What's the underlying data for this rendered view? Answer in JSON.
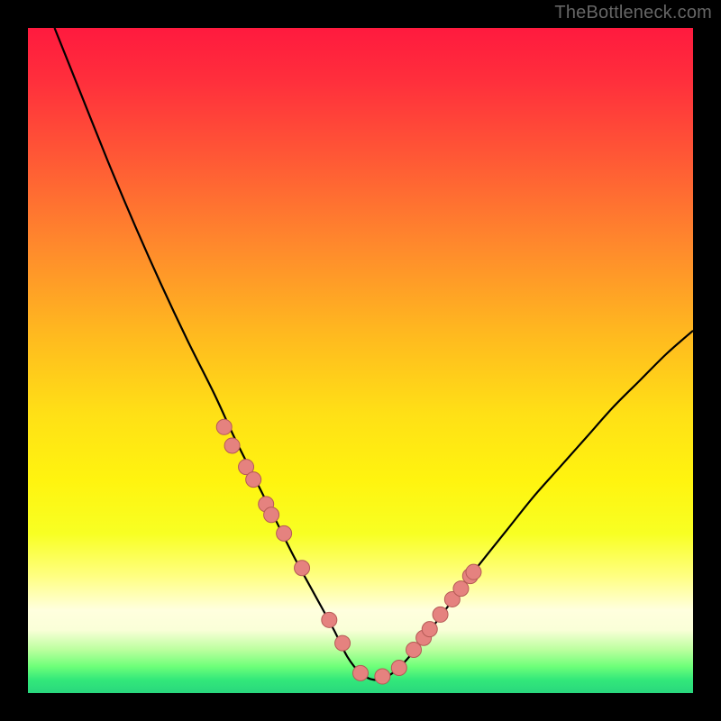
{
  "watermark": "TheBottleneck.com",
  "colors": {
    "background": "#000000",
    "curve_stroke": "#000000",
    "marker_fill": "#e5827f",
    "marker_stroke": "#b55a56",
    "watermark": "#666666"
  },
  "chart_data": {
    "type": "line",
    "title": "",
    "xlabel": "",
    "ylabel": "",
    "xlim": [
      0,
      100
    ],
    "ylim": [
      0,
      100
    ],
    "grid": false,
    "legend": false,
    "series": [
      {
        "name": "curve",
        "x": [
          4,
          8,
          12,
          16,
          20,
          24,
          28,
          31,
          34,
          37,
          40,
          43,
          46,
          48,
          50,
          52,
          54,
          56,
          59,
          62,
          65,
          68,
          72,
          76,
          80,
          84,
          88,
          92,
          96,
          100
        ],
        "y": [
          100,
          90,
          80,
          70.5,
          61.5,
          53,
          45,
          38.5,
          32.5,
          26.5,
          20.5,
          15,
          9.5,
          5.5,
          3,
          2,
          2.5,
          4,
          7.5,
          11.5,
          15.5,
          19.5,
          24.5,
          29.5,
          34,
          38.5,
          43,
          47,
          51,
          54.5
        ]
      }
    ],
    "markers": {
      "name": "highlighted-points",
      "x": [
        29.5,
        30.7,
        32.8,
        33.9,
        35.8,
        36.6,
        38.5,
        41.2,
        45.3,
        47.3,
        50.0,
        53.3,
        55.8,
        58.0,
        59.5,
        60.4,
        62.0,
        63.8,
        65.1,
        66.5,
        67.0
      ],
      "y": [
        40.0,
        37.2,
        34.0,
        32.1,
        28.4,
        26.8,
        24.0,
        18.8,
        11.0,
        7.5,
        3.0,
        2.5,
        3.8,
        6.5,
        8.3,
        9.6,
        11.8,
        14.1,
        15.7,
        17.6,
        18.2
      ]
    }
  }
}
